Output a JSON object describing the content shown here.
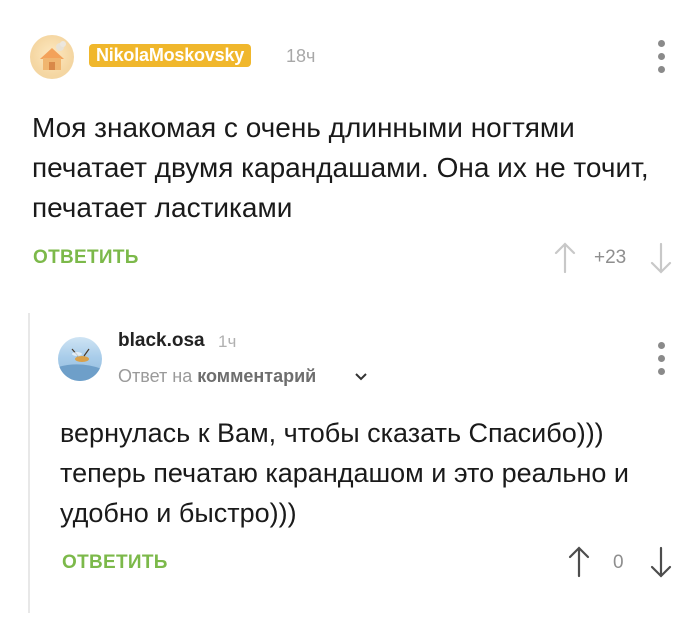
{
  "comment": {
    "author": "NikolaMoskovsky",
    "time": "18ч",
    "text": "Моя знакомая с очень длинными ногтями печатает двумя карандашами. Она их не точит, печатает ластиками",
    "reply_label": "ОТВЕТИТЬ",
    "score": "+23",
    "icons": {
      "avatar": "avatar-image",
      "menu": "more-vertical-icon",
      "up": "arrow-up-icon",
      "down": "arrow-down-icon"
    }
  },
  "reply": {
    "author": "black.osa",
    "time": "1ч",
    "reply_to_prefix": "Ответ на",
    "reply_to_target": "комментарий",
    "text": "вернулась к Вам, чтобы сказать Спасибо))) теперь печатаю карандашом и это реально и удобно и быстро)))",
    "reply_label": "ОТВЕТИТЬ",
    "score": "0",
    "icons": {
      "avatar": "avatar-image",
      "menu": "more-vertical-icon",
      "up": "arrow-up-icon",
      "down": "arrow-down-icon",
      "expand": "chevron-down-icon"
    }
  },
  "colors": {
    "accent_green": "#7cb94a",
    "badge_orange": "#f0b72c",
    "muted_gray": "#a8a8a8"
  }
}
